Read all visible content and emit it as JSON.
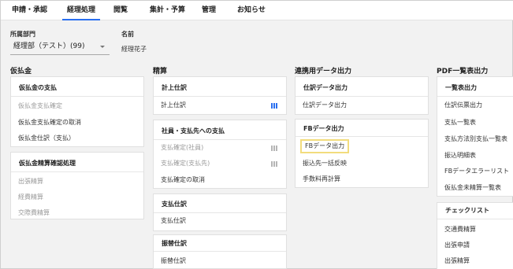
{
  "nav": {
    "tabs": [
      {
        "label": "申請・承認",
        "active": false
      },
      {
        "label": "経理処理",
        "active": true
      },
      {
        "label": "閲覧",
        "active": false
      },
      {
        "label": "集計・予算",
        "active": false
      },
      {
        "label": "管理",
        "active": false
      },
      {
        "label": "お知らせ",
        "active": false
      }
    ]
  },
  "filters": {
    "department_label": "所属部門",
    "department_value": "経理部（テスト）(99)",
    "name_label": "名前",
    "name_value": "経理花子"
  },
  "columns": {
    "advance": {
      "title": "仮払金",
      "cards": [
        {
          "title": "仮払金の支払",
          "items": [
            {
              "label": "仮払金支払確定",
              "disabled": true
            },
            {
              "label": "仮払金支払確定の取消",
              "disabled": false
            },
            {
              "label": "仮払金仕訳（支払）",
              "disabled": false
            }
          ]
        },
        {
          "title": "仮払金精算確認処理",
          "items": [
            {
              "label": "出張精算",
              "disabled": true
            },
            {
              "label": "経費精算",
              "disabled": true
            },
            {
              "label": "交際費精算",
              "disabled": true
            }
          ]
        }
      ]
    },
    "settlement": {
      "title": "精算",
      "cards": [
        {
          "title": "計上仕訳",
          "items": [
            {
              "label": "計上仕訳",
              "disabled": false
            }
          ]
        },
        {
          "title": "社員・支払先への支払",
          "items": [
            {
              "label": "支払確定(社員)",
              "disabled": true
            },
            {
              "label": "支払確定(支払先)",
              "disabled": true
            },
            {
              "label": "支払確定の取消",
              "disabled": false
            }
          ]
        },
        {
          "title": "支払仕訳",
          "items": [
            {
              "label": "支払仕訳",
              "disabled": false
            }
          ]
        },
        {
          "title": "振替仕訳",
          "items": [
            {
              "label": "振替仕訳",
              "disabled": false
            }
          ]
        }
      ]
    },
    "export": {
      "title": "連携用データ出力",
      "cards": [
        {
          "title": "仕訳データ出力",
          "items": [
            {
              "label": "仕訳データ出力",
              "disabled": false
            }
          ]
        },
        {
          "title": "FBデータ出力",
          "items": [
            {
              "label": "FBデータ出力",
              "disabled": false,
              "highlighted": true
            },
            {
              "label": "振込先一括反映",
              "disabled": false
            },
            {
              "label": "手数料再計算",
              "disabled": false
            }
          ]
        }
      ]
    },
    "pdf": {
      "title": "PDF一覧表出力",
      "cards": [
        {
          "title": "一覧表出力",
          "items": [
            {
              "label": "仕訳伝票出力",
              "disabled": false
            },
            {
              "label": "支払一覧表",
              "disabled": false
            },
            {
              "label": "支払方法別支払一覧表",
              "disabled": false
            },
            {
              "label": "振込明細表",
              "disabled": false
            },
            {
              "label": "FBデータエラーリスト",
              "disabled": false
            },
            {
              "label": "仮払金未精算一覧表",
              "disabled": false
            }
          ]
        },
        {
          "title": "チェックリスト",
          "items": [
            {
              "label": "交通費精算",
              "disabled": false
            },
            {
              "label": "出張申請",
              "disabled": false
            },
            {
              "label": "出張精算",
              "disabled": false
            }
          ]
        }
      ]
    }
  },
  "colors": {
    "accent": "#2a6ff0",
    "highlight_border": "#f2dc7d",
    "disabled_text": "#9a9a9a",
    "page_bg": "#f2f2f2"
  }
}
